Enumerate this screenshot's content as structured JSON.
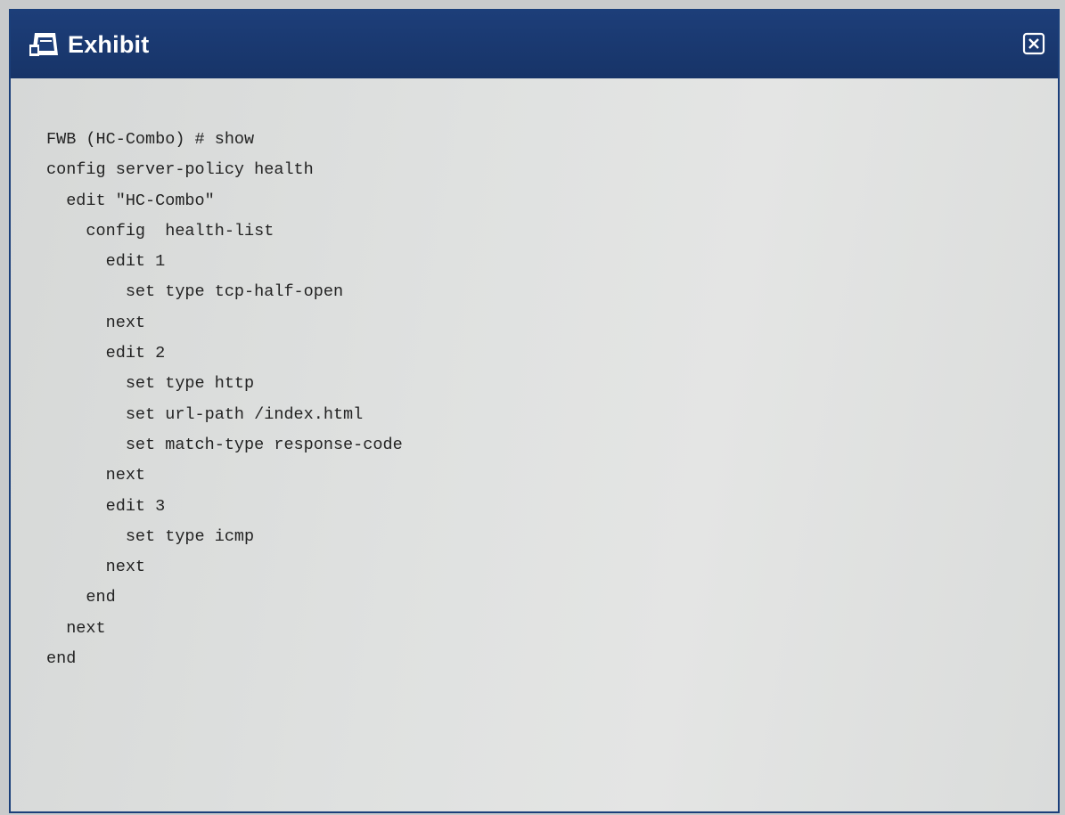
{
  "window": {
    "title": "Exhibit",
    "title_icon": "exhibit-icon",
    "close_icon": "close-icon",
    "colors": {
      "titlebar": "#1b3c75",
      "background": "#dcdedd",
      "text": "#232323"
    }
  },
  "code": {
    "lines": [
      "FWB (HC-Combo) # show",
      "config server-policy health",
      "  edit \"HC-Combo\"",
      "    config  health-list",
      "      edit 1",
      "        set type tcp-half-open",
      "      next",
      "      edit 2",
      "        set type http",
      "        set url-path /index.html",
      "        set match-type response-code",
      "      next",
      "      edit 3",
      "        set type icmp",
      "      next",
      "    end",
      "  next",
      "end"
    ]
  }
}
